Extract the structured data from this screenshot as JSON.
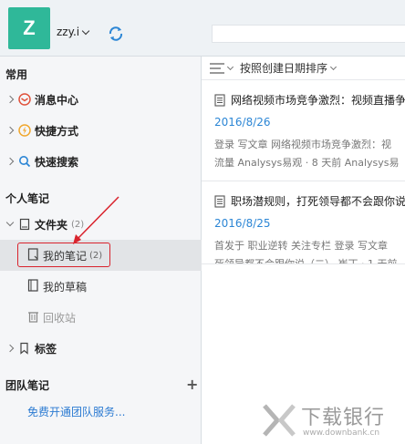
{
  "header": {
    "avatar_letter": "Z",
    "username": "zzy.i"
  },
  "sidebar": {
    "section_common": "常用",
    "common_items": [
      {
        "label": "消息中心"
      },
      {
        "label": "快捷方式"
      },
      {
        "label": "快速搜索"
      }
    ],
    "section_personal": "个人笔记",
    "folder": {
      "label": "文件夹",
      "count": "(2)"
    },
    "folder_items": [
      {
        "label": "我的笔记",
        "count": "(2)"
      },
      {
        "label": "我的草稿"
      },
      {
        "label": "回收站"
      }
    ],
    "tags_label": "标签",
    "section_team": "团队笔记",
    "team_link": "免费开通团队服务..."
  },
  "list": {
    "sort_label": "按照创建日期排序",
    "notes": [
      {
        "title": "网络视频市场竞争激烈：视频直播争",
        "date": "2016/8/26",
        "snippet_line1": "登录 写文章 网络视频市场竞争激烈：视",
        "snippet_line2": "流量 Analysys易观 · 8 天前 Analysys易"
      },
      {
        "title": "职场潜规则，打死领导都不会跟你说",
        "date": "2016/8/25",
        "snippet_line1": "首发于 职业逆转 关注专栏 登录 写文章",
        "snippet_line2": "死领导都不会跟你说（二） 崔丁 · 1 天前"
      }
    ]
  },
  "watermark": {
    "text": "下载银行",
    "url": "www.downbank.cn"
  },
  "colors": {
    "avatar": "#2fb899",
    "link": "#2c86d5",
    "highlight": "#d9232d"
  }
}
